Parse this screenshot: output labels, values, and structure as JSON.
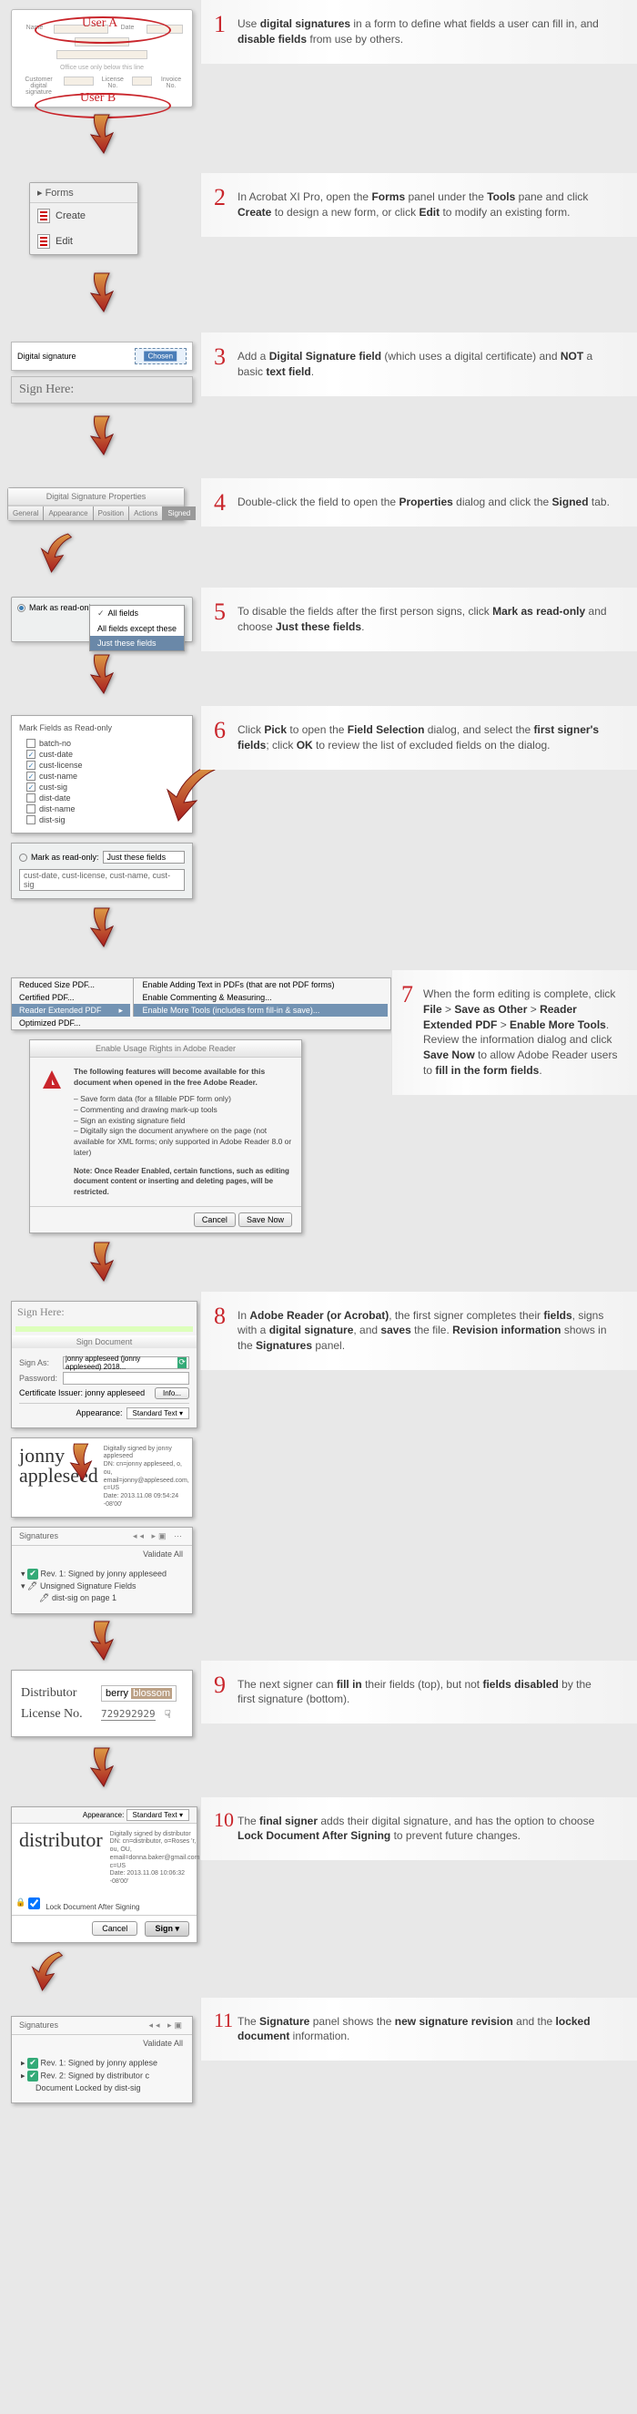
{
  "steps": {
    "s1": {
      "num": "1",
      "html": "Use <b>digital signatures</b> in a form to define what fields a user can fill in, and <b>disable fields</b> from use by others."
    },
    "s2": {
      "num": "2",
      "html": "In Acrobat XI Pro, open the <b>Forms</b> panel under the <b>Tools</b> pane and click <b>Create</b> to design a new form, or click <b>Edit</b> to modify an existing form."
    },
    "s3": {
      "num": "3",
      "html": "Add a <b>Digital Signature field</b> (which uses a digital certificate) and <b>NOT</b> a basic <b>text field</b>."
    },
    "s4": {
      "num": "4",
      "html": "Double-click the field to open the <b>Properties</b> dialog and click the <b>Signed</b> tab."
    },
    "s5": {
      "num": "5",
      "html": "To disable the fields after the first person signs, click <b>Mark as read-only</b> and choose <b>Just these fields</b>."
    },
    "s6": {
      "num": "6",
      "html": "Click <b>Pick</b> to open the <b>Field Selection</b> dialog, and select the <b>first signer's fields</b>; click <b>OK</b> to review the list of excluded fields on the dialog."
    },
    "s7": {
      "num": "7",
      "html": "When the form editing is complete, click <b>File</b> > <b>Save as Other</b> > <b>Reader Extended PDF</b> > <b>Enable More Tools</b>. Review the information dialog and click <b>Save Now</b> to allow Adobe Reader users to <b>fill in the form fields</b>."
    },
    "s8": {
      "num": "8",
      "html": "In <b>Adobe Reader (or Acrobat)</b>, the first signer completes their <b>fields</b>, signs with a <b>digital signature</b>, and <b>saves</b> the file. <b>Revision information</b> shows in the <b>Signatures</b> panel."
    },
    "s9": {
      "num": "9",
      "html": "The next signer can <b>fill in</b> their fields (top), but not <b>fields disabled</b> by the first signature (bottom)."
    },
    "s10": {
      "num": "10",
      "html": "The <b>final signer</b> adds their digital signature, and has the option to choose <b>Lock Document After Signing</b> to prevent future changes."
    },
    "s11": {
      "num": "11",
      "html": "The <b>Signature</b> panel shows the <b>new signature revision</b> and the <b>locked document</b> information."
    }
  },
  "form_mock": {
    "user_a": "User A",
    "user_b": "User B",
    "labels": {
      "name": "Name",
      "date": "Date",
      "sig": "Customer digital signature",
      "lic": "License No.",
      "invoice": "Invoice No."
    },
    "note": "Office use only below this line"
  },
  "forms_panel": {
    "title": "Forms",
    "create": "Create",
    "edit": "Edit"
  },
  "digsig": {
    "label": "Digital signature",
    "center": "Chosen",
    "sign_here": "Sign Here:"
  },
  "props": {
    "title": "Digital Signature Properties",
    "tabs": [
      "General",
      "Appearance",
      "Position",
      "Actions",
      "Signed"
    ]
  },
  "markro": {
    "label": "Mark as read-only:",
    "options": [
      "All fields",
      "All fields except these",
      "Just these fields"
    ]
  },
  "fieldlist": {
    "title": "Mark Fields as Read-only",
    "items": [
      {
        "name": "batch-no",
        "ck": false
      },
      {
        "name": "cust-date",
        "ck": true
      },
      {
        "name": "cust-license",
        "ck": true
      },
      {
        "name": "cust-name",
        "ck": true
      },
      {
        "name": "cust-sig",
        "ck": true
      },
      {
        "name": "dist-date",
        "ck": false
      },
      {
        "name": "dist-name",
        "ck": false
      },
      {
        "name": "dist-sig",
        "ck": false
      }
    ],
    "selected_mode": "Just these fields",
    "summary": "cust-date, cust-license, cust-name, cust-sig"
  },
  "save_menu": {
    "left": [
      "Reduced Size PDF...",
      "Certified PDF...",
      "Reader Extended PDF",
      "Optimized PDF..."
    ],
    "right": [
      "Enable Adding Text in PDFs (that are not PDF forms)",
      "Enable Commenting & Measuring...",
      "Enable More Tools (includes form fill-in & save)..."
    ]
  },
  "usage": {
    "title": "Enable Usage Rights in Adobe Reader",
    "intro": "The following features will become available for this document when opened in the free Adobe Reader.",
    "items": [
      "Save form data (for a fillable PDF form only)",
      "Commenting and drawing mark-up tools",
      "Sign an existing signature field",
      "Digitally sign the document anywhere on the page (not available for XML forms; only supported in Adobe Reader 8.0 or later)"
    ],
    "note": "Note: Once Reader Enabled, certain functions, such as editing document content or inserting and deleting pages, will be restricted.",
    "cancel": "Cancel",
    "save": "Save Now"
  },
  "sign_doc": {
    "sign_here": "Sign Here:",
    "title": "Sign Document",
    "sign_as_l": "Sign As:",
    "sign_as_v": "jonny appleseed (jonny appleseed) 2018...",
    "pw_l": "Password:",
    "issuer_l": "Certificate Issuer:",
    "issuer_v": "jonny appleseed",
    "info": "Info...",
    "appearance_l": "Appearance:",
    "appearance_v": "Standard Text"
  },
  "sig_img": {
    "name": "jonny appleseed",
    "meta": "Digitally signed by jonny appleseed\nDN: cn=jonny appleseed, o, ou, email=jonny@appleseed.com, c=US\nDate: 2013.11.08 09:54:24 -08'00'"
  },
  "sig_panel": {
    "title": "Signatures",
    "validate": "Validate All",
    "rev1": "Rev. 1: Signed by jonny appleseed",
    "unsigned": "Unsigned Signature Fields",
    "pg": "dist-sig on page 1"
  },
  "dist": {
    "l1": "Distributor",
    "v1a": "berry ",
    "v1b": "blossom",
    "l2": "License No.",
    "v2": "729292929"
  },
  "sig_dist": {
    "appearance_l": "Appearance:",
    "appearance_v": "Standard Text",
    "name": "distributor",
    "meta": "Digitally signed by distributor\nDN: cn=distributor, o=Roses 'r, ou, OU,\nemail=donna.baker@gmail.com, c=US\nDate: 2013.11.08 10:06:32 -08'00'",
    "lock": "Lock Document After Signing",
    "cancel": "Cancel",
    "sign": "Sign"
  },
  "sig_panel2": {
    "title": "Signatures",
    "validate": "Validate All",
    "rev1": "Rev. 1: Signed by jonny applese",
    "rev2": "Rev. 2: Signed by distributor c",
    "locked": "Document Locked by dist-sig"
  }
}
